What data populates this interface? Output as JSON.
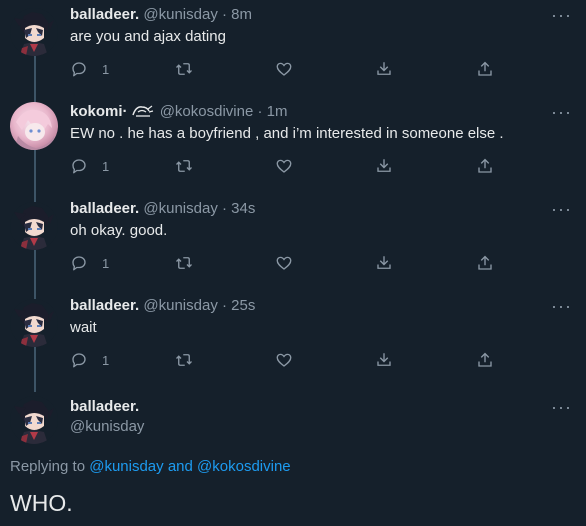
{
  "colors": {
    "background": "#15202b",
    "text": "#e7e9ea",
    "secondary": "#8b98a5",
    "accent": "#1d9bf0",
    "thread_line": "#3d5466"
  },
  "tweets": [
    {
      "name": "balladeer.",
      "handle": "@kunisday",
      "time": "8m",
      "text": "are you and ajax dating",
      "reply_count": "1",
      "avatar": "balladeer-avatar"
    },
    {
      "name": "kokomi·",
      "handle": "@kokosdivine",
      "time": "1m",
      "text": "EW no . he has a boyfriend , and i’m interested in someone else .",
      "reply_count": "1",
      "avatar": "kokomi-avatar",
      "name_icon": "waving-hand-icon"
    },
    {
      "name": "balladeer.",
      "handle": "@kunisday",
      "time": "34s",
      "text": "oh okay. good.",
      "reply_count": "1",
      "avatar": "balladeer-avatar"
    },
    {
      "name": "balladeer.",
      "handle": "@kunisday",
      "time": "25s",
      "text": "wait",
      "reply_count": "1",
      "avatar": "balladeer-avatar"
    }
  ],
  "separator": "·",
  "main_tweet": {
    "name": "balladeer.",
    "handle": "@kunisday",
    "replying_prefix": "Replying to",
    "mention_1": "@kunisday",
    "and": "and",
    "mention_2": "@kokosdivine",
    "text": "WHO."
  },
  "more_label": "···"
}
